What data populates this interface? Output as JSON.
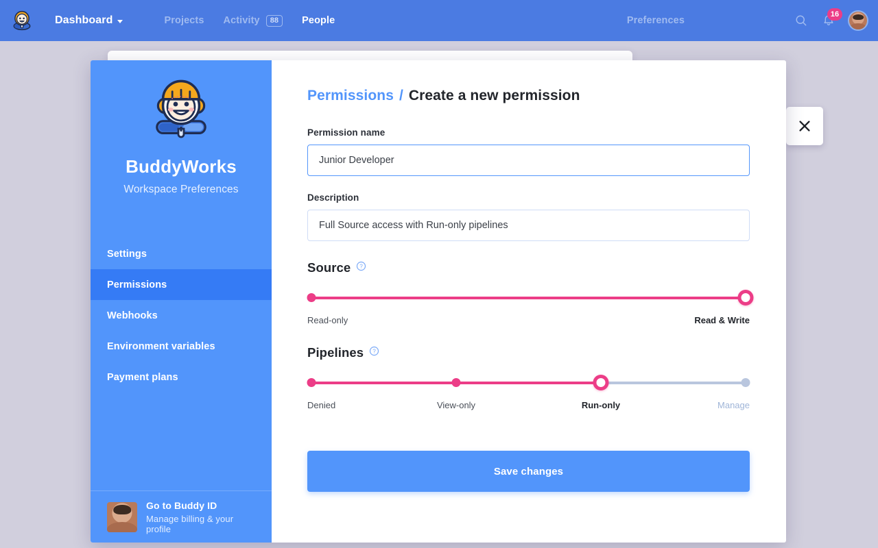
{
  "topbar": {
    "logo_icon": "buddy-mascot-icon",
    "dashboard_label": "Dashboard",
    "nav_links": [
      {
        "label": "Projects",
        "active": false,
        "badge": null
      },
      {
        "label": "Activity",
        "active": false,
        "badge": "88"
      },
      {
        "label": "People",
        "active": true,
        "badge": null
      }
    ],
    "preferences_label": "Preferences",
    "search_icon": "search-icon",
    "bell_icon": "bell-icon",
    "notification_count": "16",
    "avatar_icon": "user-avatar",
    "bg_color": "#4b7be2",
    "badge_color": "#ec3d87"
  },
  "modal": {
    "close_icon": "close-icon",
    "sidebar": {
      "mascot_icon": "buddy-mascot-icon",
      "title": "BuddyWorks",
      "subtitle": "Workspace Preferences",
      "bg_color": "#5295fb",
      "active_color": "#357bf5",
      "items": [
        {
          "label": "Settings",
          "active": false
        },
        {
          "label": "Permissions",
          "active": true
        },
        {
          "label": "Webhooks",
          "active": false
        },
        {
          "label": "Environment variables",
          "active": false
        },
        {
          "label": "Payment plans",
          "active": false
        }
      ],
      "footer": {
        "avatar_icon": "user-avatar",
        "title": "Go to Buddy ID",
        "subtitle": "Manage billing & your profile"
      }
    },
    "content": {
      "breadcrumb": {
        "parent": "Permissions",
        "separator": "/",
        "current": "Create a new permission"
      },
      "permission_name": {
        "label": "Permission name",
        "value": "Junior Developer",
        "placeholder": "Permission name"
      },
      "description": {
        "label": "Description",
        "value": "Full Source access with Run-only pipelines",
        "placeholder": "Description"
      },
      "source_slider": {
        "title": "Source",
        "help_icon": "help-circle-icon",
        "steps": [
          "Read-only",
          "Read & Write"
        ],
        "selected_index": 1,
        "selected_label": "Read & Write",
        "fill_color": "#ec3d87",
        "track_color": "#b9c6de"
      },
      "pipelines_slider": {
        "title": "Pipelines",
        "help_icon": "help-circle-icon",
        "steps": [
          "Denied",
          "View-only",
          "Run-only",
          "Manage"
        ],
        "selected_index": 2,
        "selected_label": "Run-only",
        "fill_color": "#ec3d87",
        "track_color": "#b9c6de"
      },
      "save_button": {
        "label": "Save changes",
        "color": "#5295fb"
      }
    }
  },
  "page": {
    "overlay_color": "#d1cfdd"
  }
}
